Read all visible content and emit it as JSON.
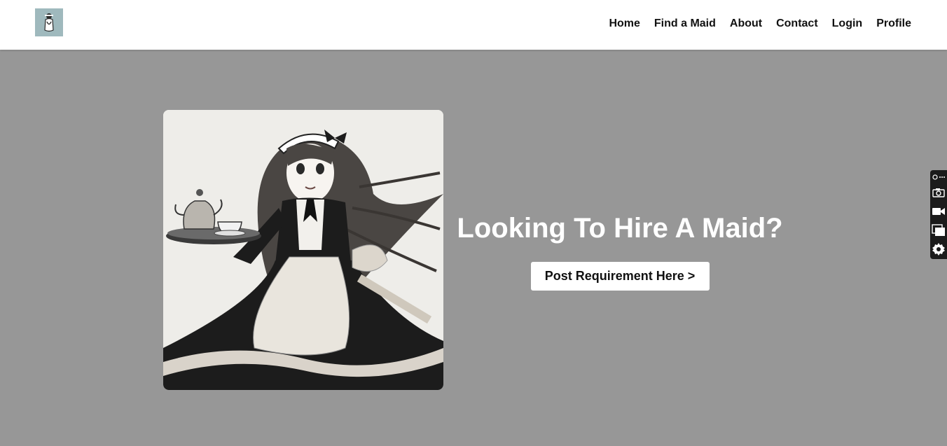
{
  "nav": {
    "items": [
      "Home",
      "Find a Maid",
      "About",
      "Contact",
      "Login",
      "Profile"
    ]
  },
  "hero": {
    "heading": "Looking To Hire A Maid?",
    "cta_label": "Post Requirement Here >"
  },
  "icons": {
    "logo": "maid-logo-icon",
    "toolbar": [
      "link-more-icon",
      "camera-icon",
      "video-icon",
      "window-icon",
      "gear-icon"
    ]
  },
  "colors": {
    "page_bg": "#979797",
    "navbar_bg": "#ffffff",
    "logo_bg": "#9fb9bd",
    "heading": "#ffffff",
    "toolbar_bg": "#1b1b1b"
  }
}
